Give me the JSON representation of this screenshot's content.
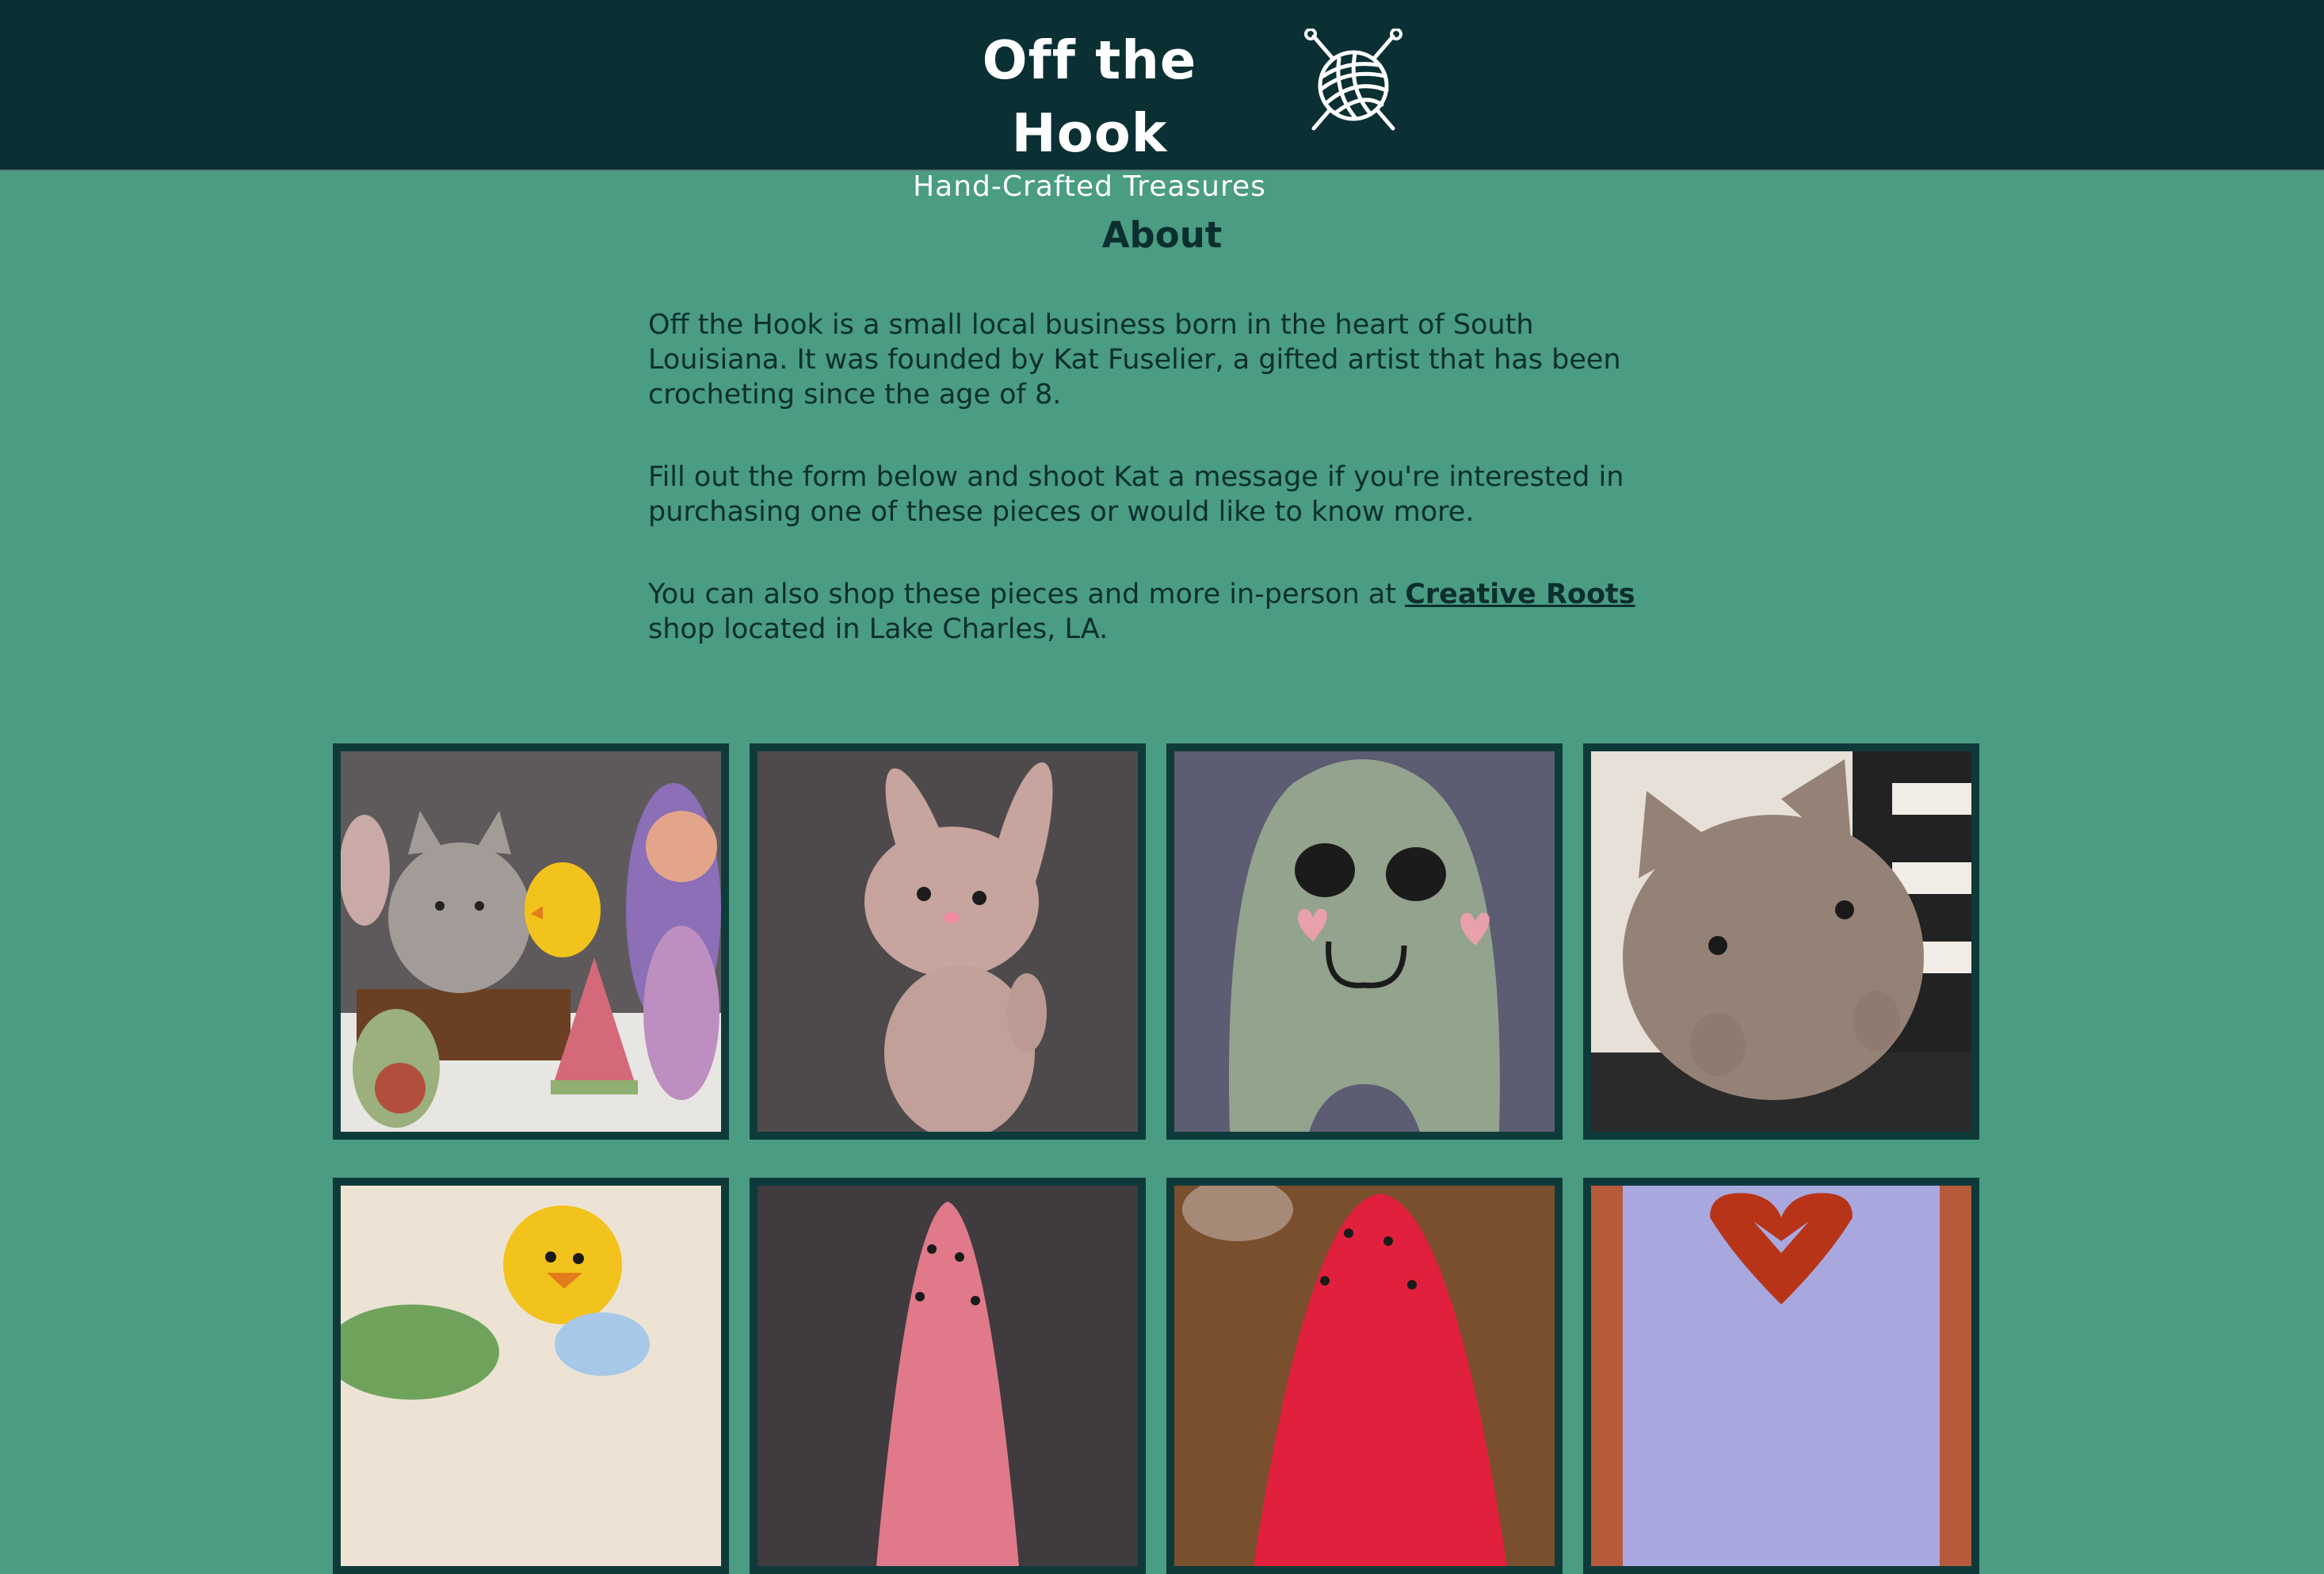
{
  "header": {
    "title": "Off the Hook",
    "subtitle": "Hand-Crafted Treasures",
    "logo_icon": "yarn-ball-with-needles-icon"
  },
  "about": {
    "heading": "About",
    "paragraph1": "Off the Hook is a small local business born in the heart of South Louisiana. It was founded by Kat Fuselier, a gifted artist that has been crocheting since the age of 8.",
    "paragraph2": "Fill out the form below and shoot Kat a message if you're interested in purchasing one of these pieces or would like to know more.",
    "paragraph3_before": "You can also shop these pieces and more in-person at ",
    "paragraph3_link": "Creative Roots",
    "paragraph3_after": " shop located in Lake Charles, LA."
  },
  "gallery": {
    "items": [
      {
        "subject": "crochet-group-photo"
      },
      {
        "subject": "crochet-bunny"
      },
      {
        "subject": "crochet-ghost"
      },
      {
        "subject": "crochet-cat"
      },
      {
        "subject": "crochet-chick"
      },
      {
        "subject": "crochet-pink-watermelon"
      },
      {
        "subject": "crochet-red-watermelon"
      },
      {
        "subject": "crochet-heart-blanket"
      }
    ]
  },
  "colors": {
    "header_bg": "#0a3033",
    "page_bg": "#4a9c82",
    "text": "#0b2f2e",
    "tile_border": "#0f3a3a"
  }
}
